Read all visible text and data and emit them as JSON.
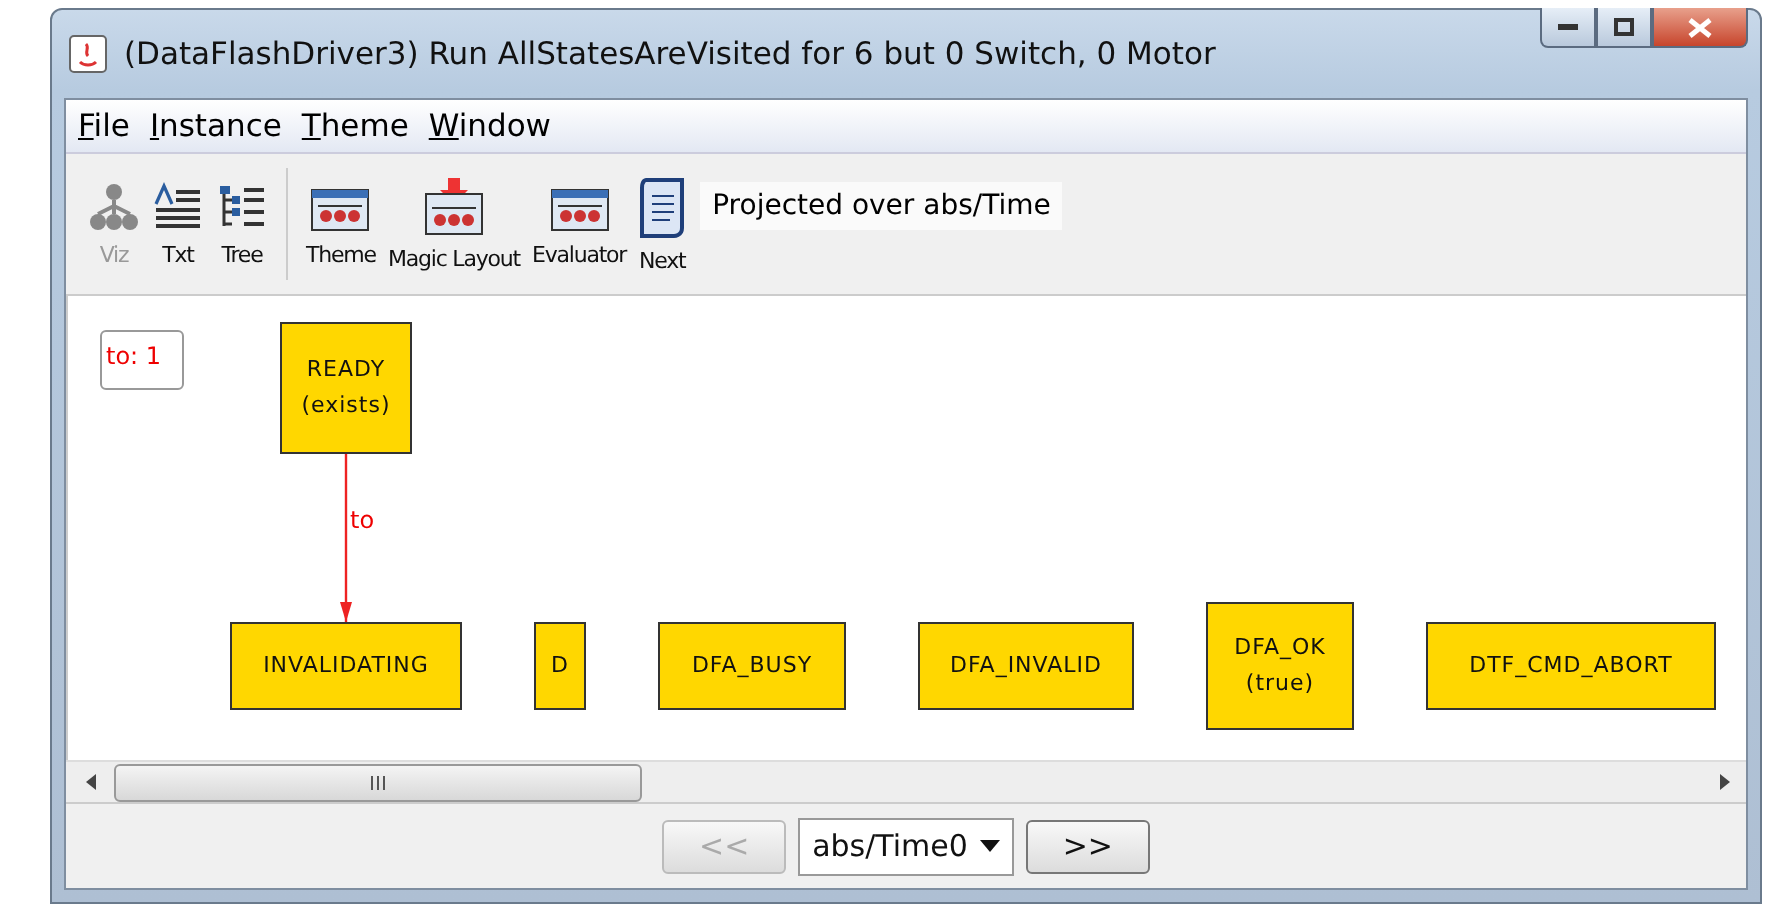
{
  "window": {
    "title": "(DataFlashDriver3) Run AllStatesAreVisited for 6 but 0 Switch, 0 Motor"
  },
  "menu": [
    {
      "label": "File"
    },
    {
      "label": "Instance"
    },
    {
      "label": "Theme"
    },
    {
      "label": "Window"
    }
  ],
  "toolbar": {
    "buttons": [
      {
        "label": "Viz",
        "kind": "viz",
        "disabled": true
      },
      {
        "label": "Txt",
        "kind": "txt",
        "disabled": false
      },
      {
        "label": "Tree",
        "kind": "tree",
        "disabled": false
      },
      {
        "label": "Theme",
        "kind": "theme",
        "disabled": false
      },
      {
        "label": "Magic Layout",
        "kind": "magic",
        "disabled": false
      },
      {
        "label": "Evaluator",
        "kind": "theme",
        "disabled": false
      },
      {
        "label": "Next",
        "kind": "next",
        "disabled": false
      }
    ],
    "projection": "Projected over abs/Time"
  },
  "diagram": {
    "legend": "to: 1",
    "nodes": [
      {
        "label": "READY",
        "sublabel": "(exists)"
      },
      {
        "label": "INVALIDATING"
      },
      {
        "label": "D"
      },
      {
        "label": "DFA_BUSY"
      },
      {
        "label": "DFA_INVALID"
      },
      {
        "label": "DFA_OK",
        "sublabel": "(true)"
      },
      {
        "label": "DTF_CMD_ABORT"
      }
    ],
    "edges": [
      {
        "label": "to"
      }
    ]
  },
  "navigation": {
    "previous": {
      "label": "<<",
      "disabled": true
    },
    "time": "abs/Time0",
    "next": {
      "label": ">>",
      "disabled": false
    }
  }
}
